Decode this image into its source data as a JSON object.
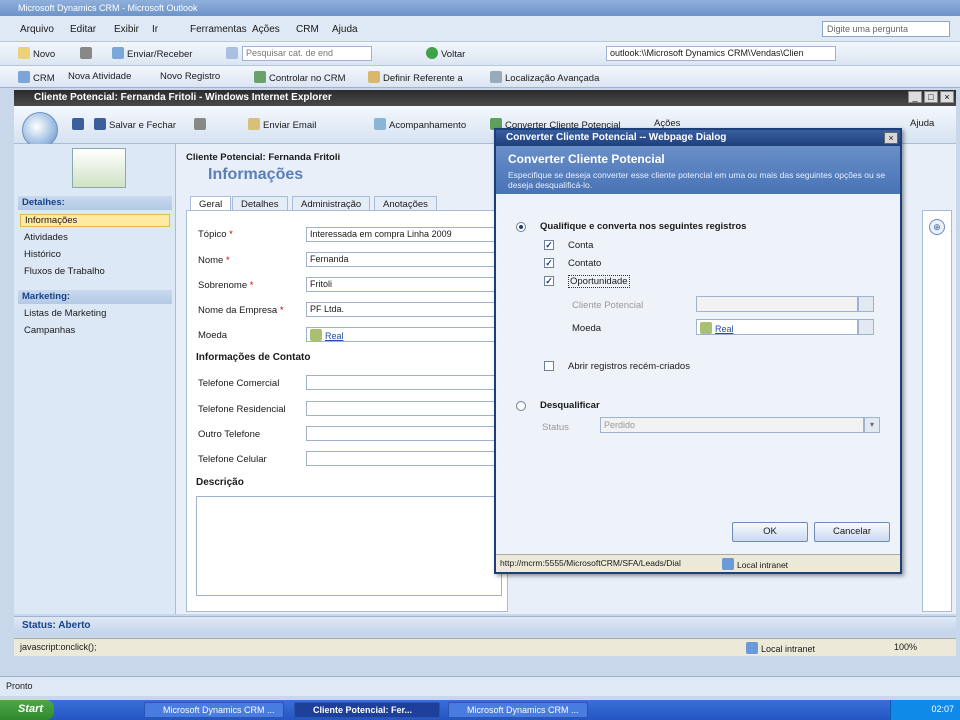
{
  "outer_window": {
    "title": "Microsoft Dynamics CRM - Microsoft Outlook",
    "menu": [
      "Arquivo",
      "Editar",
      "Exibir",
      "Ir",
      "Ferramentas",
      "Ações",
      "CRM",
      "Ajuda"
    ],
    "ask_placeholder": "Digite uma pergunta",
    "toolbar1": {
      "new": "Novo",
      "send_receive": "Enviar/Receber",
      "search_placeholder": "Pesquisar cat. de end",
      "back": "Voltar",
      "address": "outlook:\\\\Microsoft Dynamics CRM\\Vendas\\Clien"
    },
    "toolbar2": {
      "crm": "CRM",
      "new_activity": "Nova Atividade",
      "new_record": "Novo Registro",
      "track": "Controlar no CRM",
      "set_regarding": "Definir Referente a",
      "advanced_find": "Localização Avançada"
    },
    "status_text": "Pronto"
  },
  "ie_window": {
    "title": "Cliente Potencial: Fernanda Fritoli - Windows Internet Explorer",
    "toolbar": {
      "save_close": "Salvar e Fechar",
      "send_email": "Enviar Email",
      "followup": "Acompanhamento",
      "convert": "Converter Cliente Potencial",
      "more": "Ações",
      "help": "Ajuda"
    },
    "status_left": "javascript:onclick();",
    "status_zone": "Local intranet",
    "zoom": "100%"
  },
  "record": {
    "entity_title": "Cliente Potencial: Fernanda Fritoli",
    "section_title": "Informações"
  },
  "nav": {
    "details_head": "Detalhes:",
    "details_items": [
      "Informações",
      "Atividades",
      "Histórico",
      "Fluxos de Trabalho"
    ],
    "marketing_head": "Marketing:",
    "marketing_items": [
      "Listas de Marketing",
      "Campanhas"
    ]
  },
  "tabs": [
    "Geral",
    "Detalhes",
    "Administração",
    "Anotações"
  ],
  "form": {
    "topic_label": "Tópico",
    "topic_value": "Interessada em compra Linha 2009",
    "first_name_label": "Nome",
    "first_name_value": "Fernanda",
    "last_name_label": "Sobrenome",
    "last_name_value": "Fritoli",
    "company_label": "Nome da Empresa",
    "company_value": "PF Ltda.",
    "currency_label": "Moeda",
    "currency_value": "Real",
    "contact_section": "Informações de Contato",
    "work_phone_label": "Telefone Comercial",
    "home_phone_label": "Telefone Residencial",
    "other_phone_label": "Outro Telefone",
    "mobile_label": "Telefone Celular",
    "description_label": "Descrição"
  },
  "status_section": "Status: Aberto",
  "dialog": {
    "title": "Converter Cliente Potencial -- Webpage Dialog",
    "header": "Converter Cliente Potencial",
    "description": "Especifique se deseja converter esse cliente potencial em uma ou mais das seguintes opções ou se deseja desqualificá-lo.",
    "qualify_label": "Qualifique e converta nos seguintes registros",
    "account_label": "Conta",
    "contact_label": "Contato",
    "opportunity_label": "Oportunidade",
    "potential_customer_label": "Cliente Potencial",
    "currency_label": "Moeda",
    "currency_value": "Real",
    "open_new_label": "Abrir registros recém-criados",
    "disqualify_label": "Desqualificar",
    "status_label": "Status",
    "status_value": "Perdido",
    "ok": "OK",
    "cancel": "Cancelar",
    "status_url": "http://mcrm:5555/MicrosoftCRM/SFA/Leads/Dial",
    "status_zone": "Local intranet"
  },
  "taskbar": {
    "start": "Start",
    "tasks": [
      "Microsoft Dynamics CRM ...",
      "Cliente Potencial: Fer...",
      "Microsoft Dynamics CRM ..."
    ],
    "clock": "02:07"
  }
}
